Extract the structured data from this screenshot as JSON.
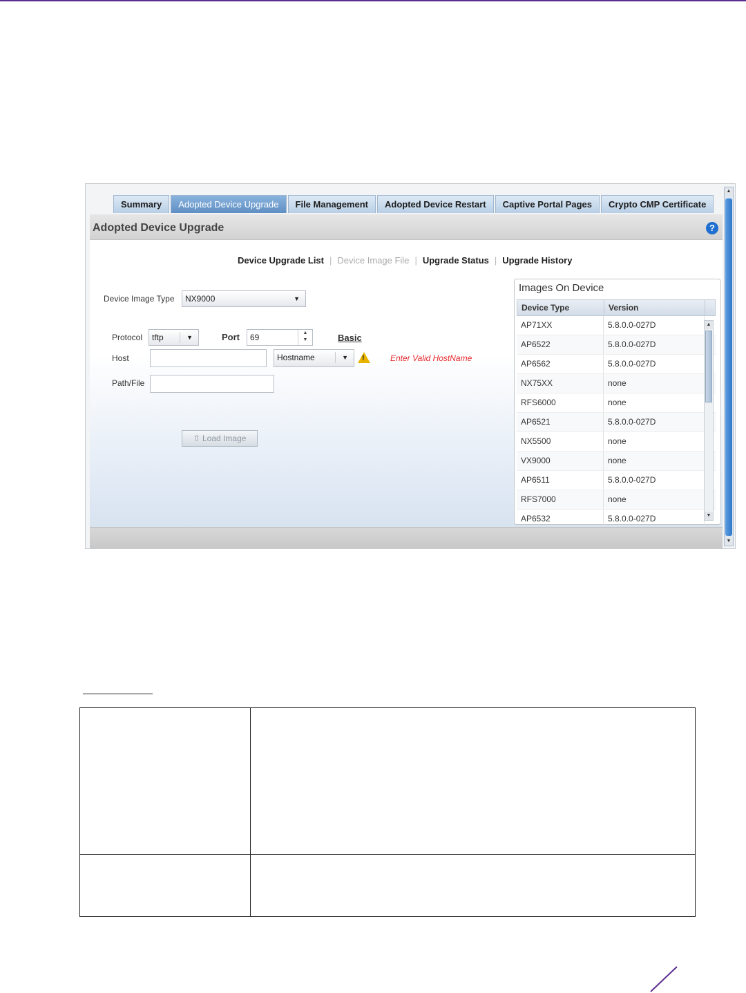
{
  "tabs": [
    {
      "label": "Summary",
      "active": false
    },
    {
      "label": "Adopted Device Upgrade",
      "active": true
    },
    {
      "label": "File Management",
      "active": false
    },
    {
      "label": "Adopted Device Restart",
      "active": false
    },
    {
      "label": "Captive Portal Pages",
      "active": false
    },
    {
      "label": "Crypto CMP Certificate",
      "active": false
    }
  ],
  "panel": {
    "title": "Adopted Device Upgrade",
    "help_icon": "question-circle-icon"
  },
  "subnav": {
    "device_upgrade_list": "Device Upgrade List",
    "device_image_file": "Device Image File",
    "upgrade_status": "Upgrade Status",
    "upgrade_history": "Upgrade History"
  },
  "form": {
    "device_image_type_label": "Device Image Type",
    "device_image_type_value": "NX9000",
    "protocol_label": "Protocol",
    "protocol_value": "tftp",
    "port_label": "Port",
    "port_value": "69",
    "basic_link": "Basic",
    "host_label": "Host",
    "host_value": "",
    "host_type_value": "Hostname",
    "host_error": "Enter Valid HostName",
    "path_label": "Path/File",
    "path_value": "",
    "load_button": "Load Image"
  },
  "images_on_device": {
    "title": "Images On Device",
    "columns": [
      "Device Type",
      "Version"
    ],
    "rows": [
      [
        "AP71XX",
        "5.8.0.0-027D"
      ],
      [
        "AP6522",
        "5.8.0.0-027D"
      ],
      [
        "AP6562",
        "5.8.0.0-027D"
      ],
      [
        "NX75XX",
        "none"
      ],
      [
        "RFS6000",
        "none"
      ],
      [
        "AP6521",
        "5.8.0.0-027D"
      ],
      [
        "NX5500",
        "none"
      ],
      [
        "VX9000",
        "none"
      ],
      [
        "AP6511",
        "5.8.0.0-027D"
      ],
      [
        "RFS7000",
        "none"
      ],
      [
        "AP6532",
        "5.8.0.0-027D"
      ]
    ]
  },
  "colors": {
    "accent": "#5b2d91",
    "active_tab": "#6b9ad0",
    "error": "#e8282d",
    "warning": "#e8b400"
  }
}
